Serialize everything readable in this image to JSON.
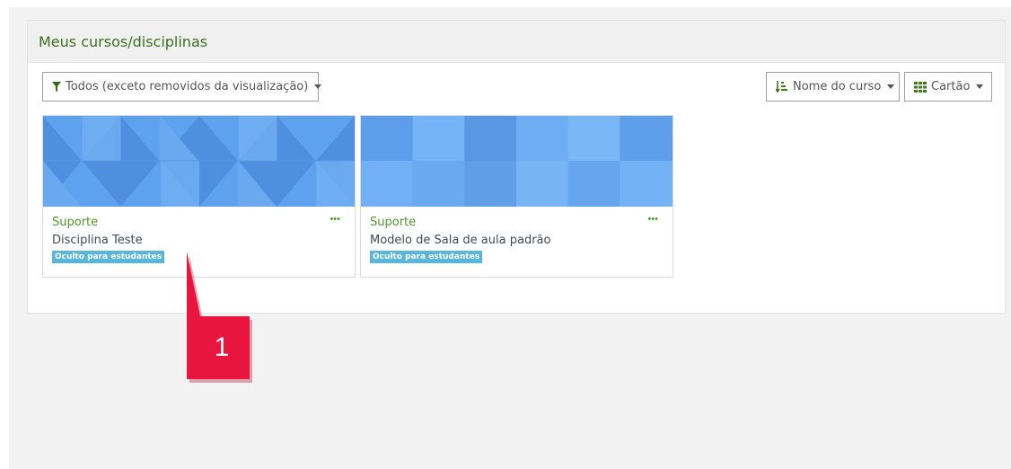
{
  "block": {
    "title": "Meus cursos/disciplinas"
  },
  "filter": {
    "label": "Todos (exceto removidos da visualização)",
    "icon": "filter-icon"
  },
  "sort": {
    "label": "Nome do curso",
    "icon": "sort-icon"
  },
  "view": {
    "label": "Cartão",
    "icon": "grid-icon"
  },
  "courses": [
    {
      "category": "Suporte",
      "name": "Disciplina Teste",
      "badge": "Oculto para estudantes",
      "menu": "•••"
    },
    {
      "category": "Suporte",
      "name": "Modelo de Sala de aula padrão",
      "badge": "Oculto para estudantes",
      "menu": "•••"
    }
  ],
  "annotation": {
    "number": "1"
  },
  "colors": {
    "accent_green": "#4c9a2a",
    "badge_blue": "#58b5dc",
    "card_blue": "#6fa8ef",
    "annotation_red": "#e8153f"
  }
}
